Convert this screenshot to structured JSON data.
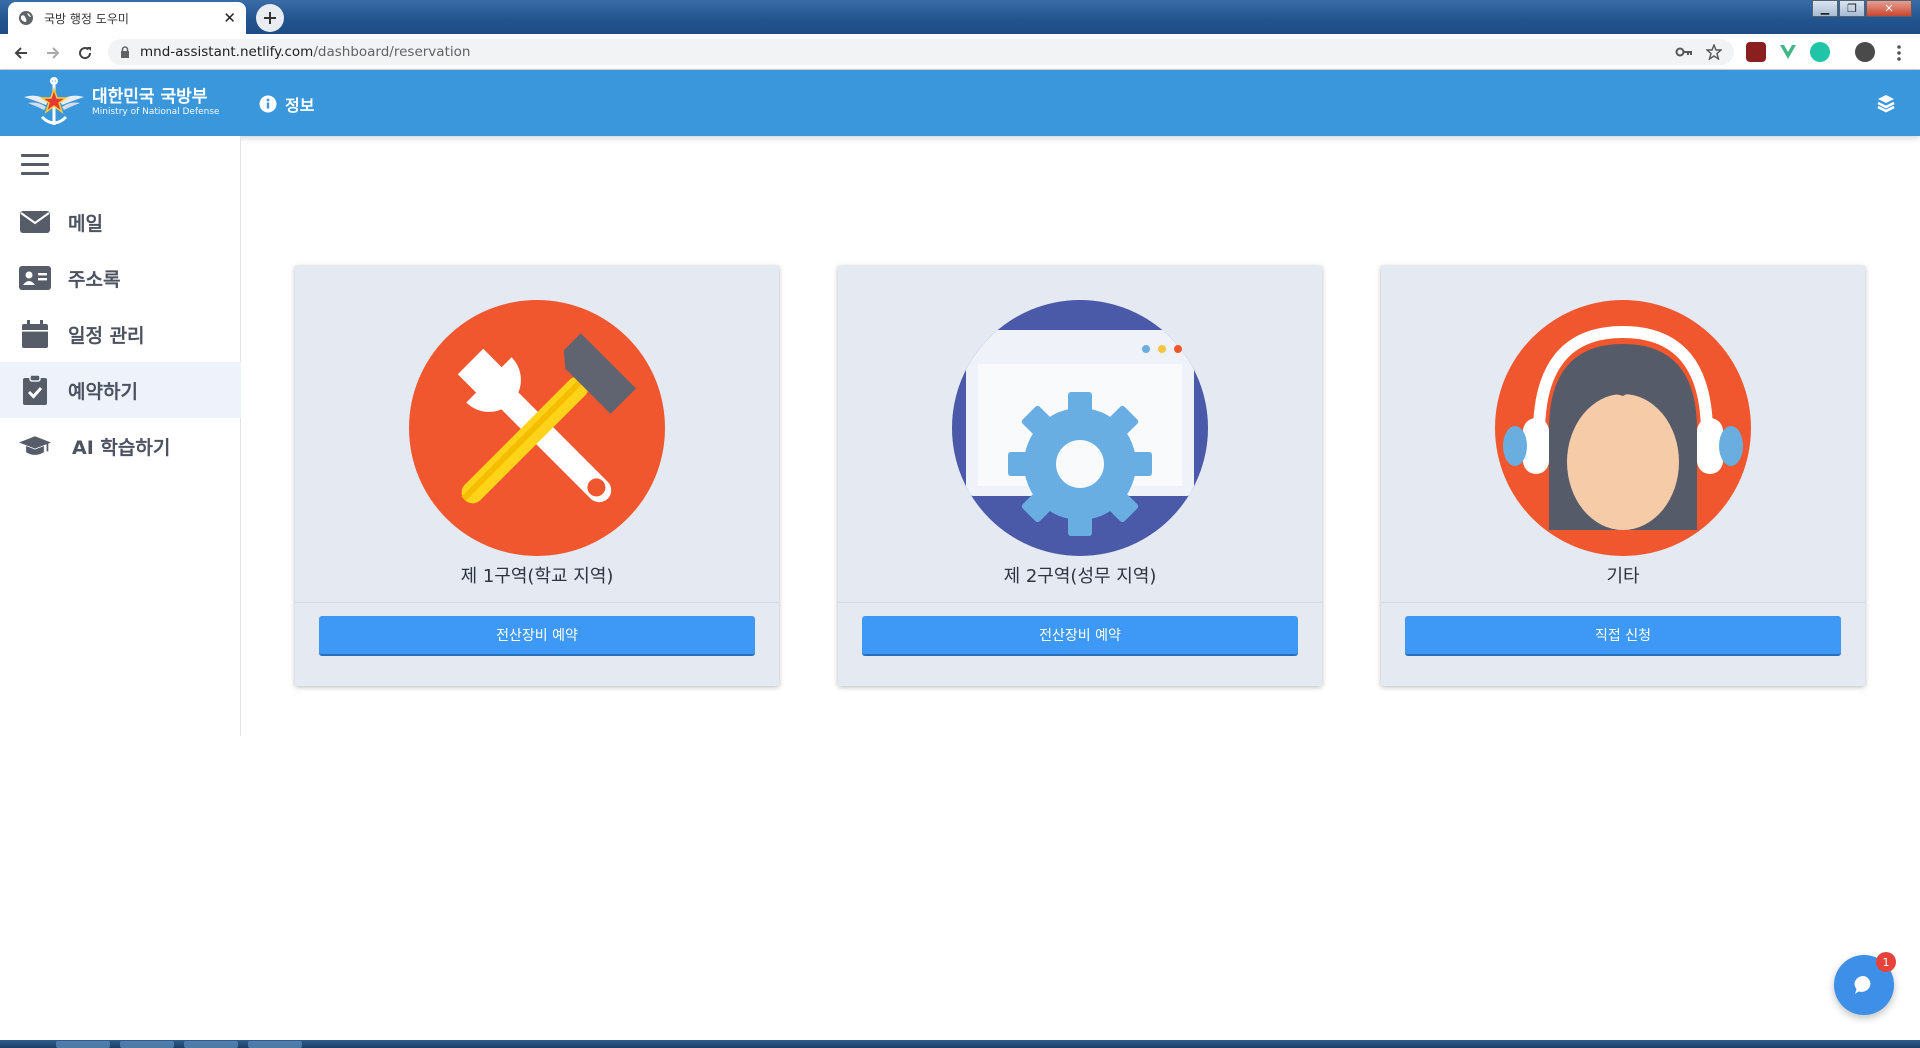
{
  "browser": {
    "tab_title": "국방 행정 도우미",
    "url_host": "mnd-assistant.netlify.com",
    "url_path": "/dashboard/reservation"
  },
  "header": {
    "brand_ko": "대한민국 국방부",
    "brand_en": "Ministry of National Defense",
    "info_label": "정보"
  },
  "sidebar": {
    "items": [
      {
        "label": "메일",
        "icon": "envelope-icon"
      },
      {
        "label": "주소록",
        "icon": "address-card-icon"
      },
      {
        "label": "일정 관리",
        "icon": "calendar-icon"
      },
      {
        "label": "예약하기",
        "icon": "clipboard-check-icon",
        "active": true
      },
      {
        "label": "AI 학습하기",
        "icon": "graduation-cap-icon"
      }
    ]
  },
  "cards": [
    {
      "title": "제 1구역(학교 지역)",
      "button": "전산장비 예약",
      "icon": "hammer-wrench-icon"
    },
    {
      "title": "제 2구역(성무 지역)",
      "button": "전산장비 예약",
      "icon": "gear-window-icon"
    },
    {
      "title": "기타",
      "button": "직접 신청",
      "icon": "headset-user-icon"
    }
  ],
  "chat": {
    "badge": "1"
  },
  "colors": {
    "header_bg": "#3a97dc",
    "card_bg": "#e4e9f2",
    "button_bg": "#3d99f5",
    "active_item_bg": "#eef3fb"
  }
}
